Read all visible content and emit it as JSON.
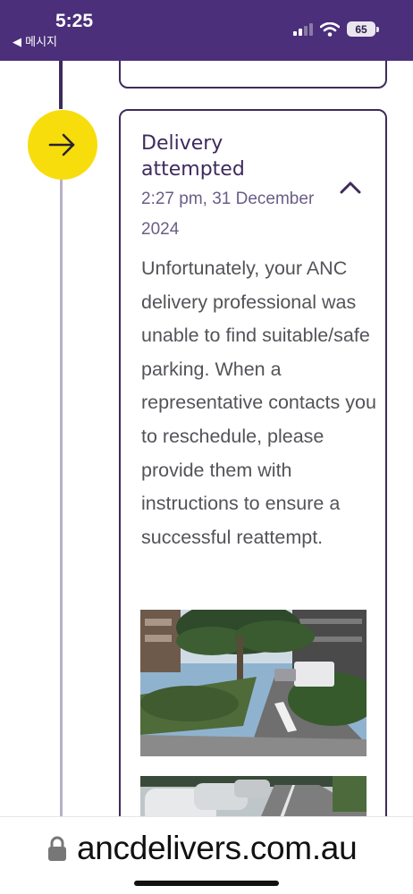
{
  "status_bar": {
    "time": "5:25",
    "back_label": "◀ 메시지",
    "battery": "65",
    "icons": [
      "signal-icon",
      "wifi-icon",
      "battery-icon"
    ]
  },
  "event": {
    "icon": "arrow-right-icon",
    "title": "Delivery attempted",
    "timestamp": "2:27 pm, 31 December 2024",
    "expanded": true,
    "description": "Unfortunately, your ANC delivery professional was unable to find suitable/safe parking. When a representative contacts you to reschedule, please provide them with instructions to ensure a successful reattempt."
  },
  "browser": {
    "url": "ancdelivers.com.au"
  },
  "colors": {
    "brand_purple": "#4b2f7a",
    "dark_purple": "#3d2b5c",
    "status_yellow": "#f7dd0c"
  }
}
